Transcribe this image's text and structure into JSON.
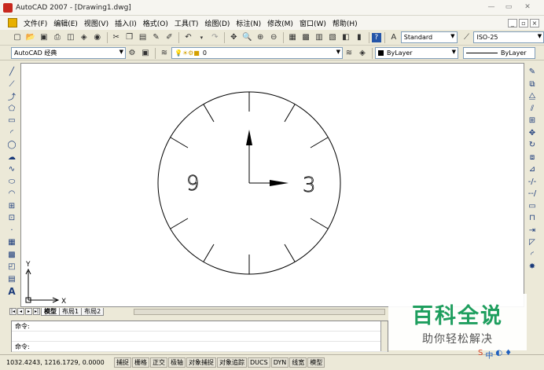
{
  "window": {
    "title": "AutoCAD 2007 - [Drawing1.dwg]"
  },
  "menu": [
    "文件(F)",
    "编辑(E)",
    "视图(V)",
    "插入(I)",
    "格式(O)",
    "工具(T)",
    "绘图(D)",
    "标注(N)",
    "修改(M)",
    "窗口(W)",
    "帮助(H)"
  ],
  "toolbar1": {
    "text_style": "Standard",
    "dim_style": "ISO-25"
  },
  "toolbar2": {
    "workspace": "AutoCAD 经典",
    "layer": "0",
    "color": "ByLayer",
    "linetype": "ByLayer"
  },
  "clock": {
    "numeral_left": "9",
    "numeral_right": "3"
  },
  "ucs": {
    "x_label": "X",
    "y_label": "Y"
  },
  "tabs": [
    "模型",
    "布局1",
    "布局2"
  ],
  "command": {
    "line1": "命令:",
    "line2": "命令:"
  },
  "status": {
    "coords": "1032.4243,  1216.1729,  0.0000",
    "buttons": [
      "捕捉",
      "栅格",
      "正交",
      "极轴",
      "对象捕捉",
      "对象追踪",
      "DUCS",
      "DYN",
      "线宽",
      "模型"
    ]
  },
  "watermark": {
    "title": "百科全说",
    "subtitle": "助你轻松解决"
  },
  "ime": {
    "lang": "中"
  }
}
